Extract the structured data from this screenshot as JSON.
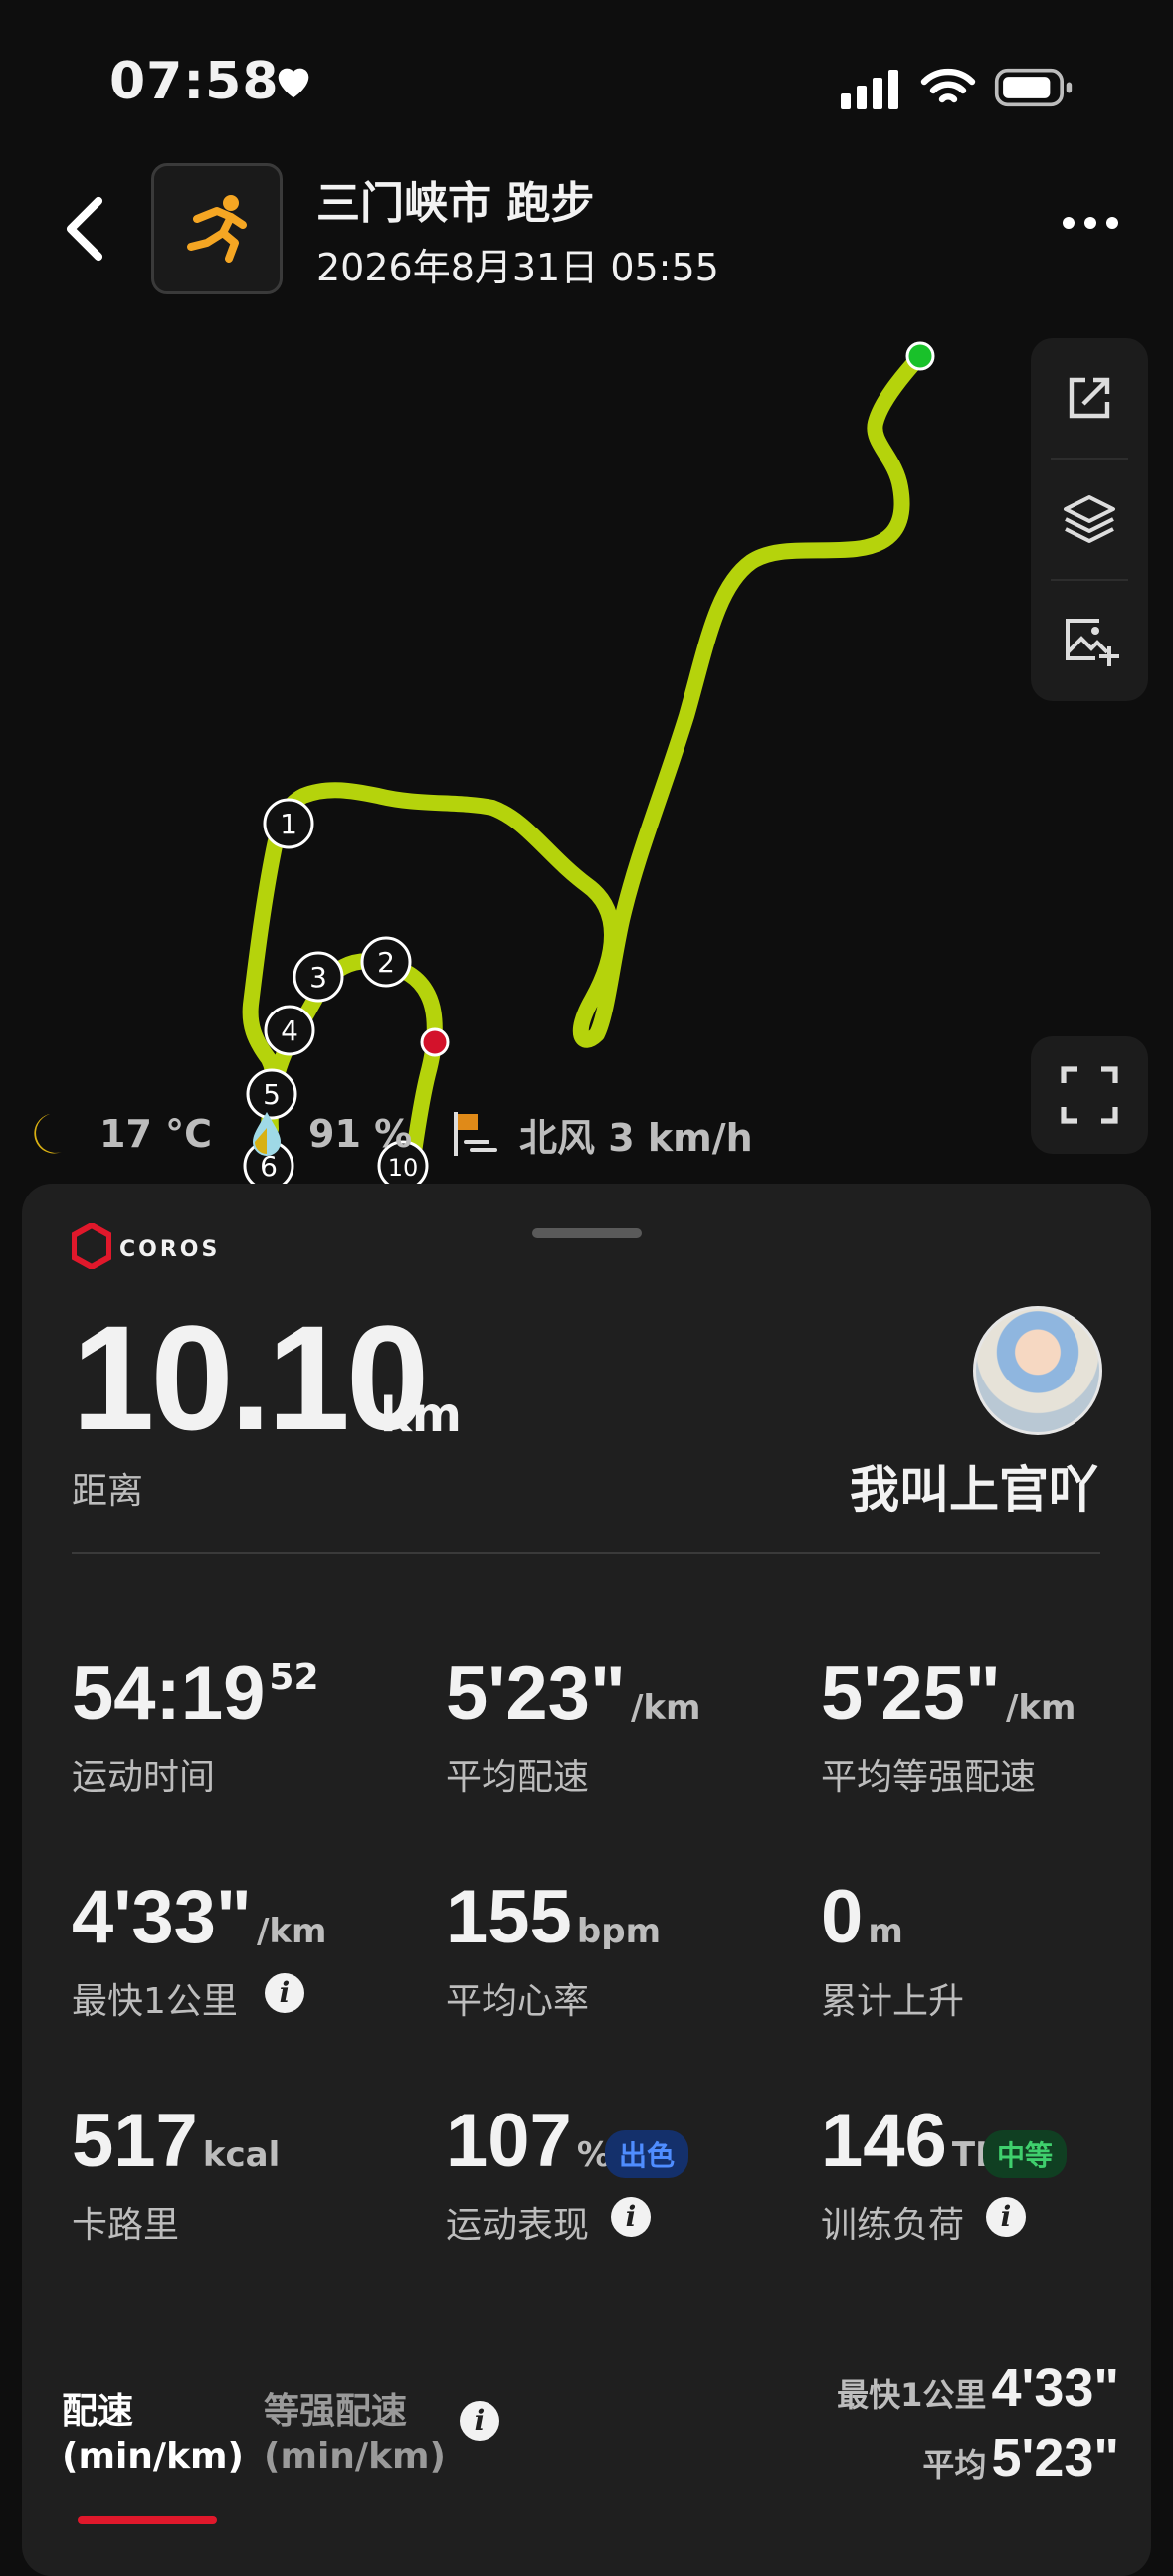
{
  "status_bar": {
    "time": "07:58"
  },
  "header": {
    "title": "三门峡市 跑步",
    "datetime": "2026年8月31日 05:55"
  },
  "map": {
    "track_color": "#b5d30c",
    "start_color": "#19c12a",
    "end_color": "#d3122b",
    "km_markers": [
      "1",
      "2",
      "3",
      "4",
      "5",
      "6",
      "10"
    ]
  },
  "weather": {
    "temperature": "17 °C",
    "humidity": "91 %",
    "wind": "北风 3 km/h"
  },
  "brand": {
    "name": "COROS"
  },
  "summary": {
    "distance_value": "10.10",
    "distance_unit": "km",
    "distance_label": "距离",
    "username": "我叫上官吖"
  },
  "stats": [
    {
      "value": "54:19",
      "sup": "52",
      "unit": "",
      "label": "运动时间"
    },
    {
      "value": "5'23\"",
      "unit": "/km",
      "label": "平均配速"
    },
    {
      "value": "5'25\"",
      "unit": "/km",
      "label": "平均等强配速"
    },
    {
      "value": "4'33\"",
      "unit": "/km",
      "label": "最快1公里"
    },
    {
      "value": "155",
      "unit": "bpm",
      "label": "平均心率"
    },
    {
      "value": "0",
      "unit": "m",
      "label": "累计上升"
    },
    {
      "value": "517",
      "unit": "kcal",
      "label": "卡路里"
    },
    {
      "value": "107",
      "unit": "%",
      "label": "运动表现",
      "badge": "出色"
    },
    {
      "value": "146",
      "unit": "TL",
      "label": "训练负荷",
      "badge": "中等"
    }
  ],
  "tabs": [
    {
      "line1": "配速",
      "line2": "(min/km)"
    },
    {
      "line1": "等强配速",
      "line2": "(min/km)"
    }
  ],
  "pace_summary": {
    "fastest_label": "最快1公里",
    "fastest_value": "4'33\"",
    "average_label": "平均",
    "average_value": "5'23\""
  }
}
